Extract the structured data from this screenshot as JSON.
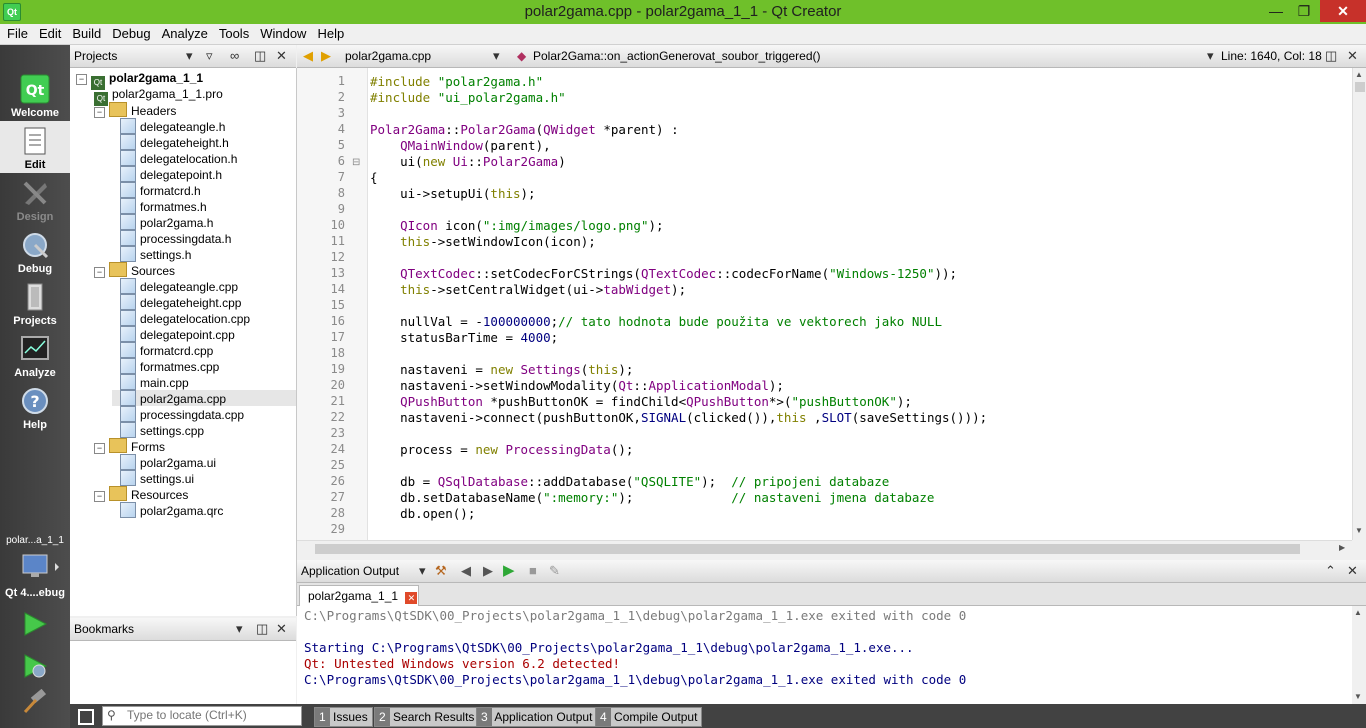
{
  "window": {
    "title": "polar2gama.cpp - polar2gama_1_1 - Qt Creator",
    "app_icon": "Qt"
  },
  "menu": [
    "File",
    "Edit",
    "Build",
    "Debug",
    "Analyze",
    "Tools",
    "Window",
    "Help"
  ],
  "modes": [
    {
      "label": "Welcome",
      "icon": "qt-logo-icon"
    },
    {
      "label": "Edit",
      "icon": "edit-document-icon"
    },
    {
      "label": "Design",
      "icon": "design-icon"
    },
    {
      "label": "Debug",
      "icon": "debug-bug-icon"
    },
    {
      "label": "Projects",
      "icon": "projects-icon"
    },
    {
      "label": "Analyze",
      "icon": "analyze-icon"
    },
    {
      "label": "Help",
      "icon": "help-icon"
    }
  ],
  "target": {
    "project": "polar...a_1_1",
    "kit": "Qt 4....ebug"
  },
  "projects_pane": {
    "title": "Projects",
    "tree": [
      {
        "label": "polar2gama_1_1",
        "level": 0,
        "kind": "project",
        "expanded": true,
        "bold": true
      },
      {
        "label": "polar2gama_1_1.pro",
        "level": 1,
        "kind": "pro"
      },
      {
        "label": "Headers",
        "level": 1,
        "kind": "folder",
        "expanded": true
      },
      {
        "label": "delegateangle.h",
        "level": 2,
        "kind": "file"
      },
      {
        "label": "delegateheight.h",
        "level": 2,
        "kind": "file"
      },
      {
        "label": "delegatelocation.h",
        "level": 2,
        "kind": "file"
      },
      {
        "label": "delegatepoint.h",
        "level": 2,
        "kind": "file"
      },
      {
        "label": "formatcrd.h",
        "level": 2,
        "kind": "file"
      },
      {
        "label": "formatmes.h",
        "level": 2,
        "kind": "file"
      },
      {
        "label": "polar2gama.h",
        "level": 2,
        "kind": "file"
      },
      {
        "label": "processingdata.h",
        "level": 2,
        "kind": "file"
      },
      {
        "label": "settings.h",
        "level": 2,
        "kind": "file"
      },
      {
        "label": "Sources",
        "level": 1,
        "kind": "folder",
        "expanded": true
      },
      {
        "label": "delegateangle.cpp",
        "level": 2,
        "kind": "file"
      },
      {
        "label": "delegateheight.cpp",
        "level": 2,
        "kind": "file"
      },
      {
        "label": "delegatelocation.cpp",
        "level": 2,
        "kind": "file"
      },
      {
        "label": "delegatepoint.cpp",
        "level": 2,
        "kind": "file"
      },
      {
        "label": "formatcrd.cpp",
        "level": 2,
        "kind": "file"
      },
      {
        "label": "formatmes.cpp",
        "level": 2,
        "kind": "file"
      },
      {
        "label": "main.cpp",
        "level": 2,
        "kind": "file"
      },
      {
        "label": "polar2gama.cpp",
        "level": 2,
        "kind": "file",
        "selected": true
      },
      {
        "label": "processingdata.cpp",
        "level": 2,
        "kind": "file"
      },
      {
        "label": "settings.cpp",
        "level": 2,
        "kind": "file"
      },
      {
        "label": "Forms",
        "level": 1,
        "kind": "folder",
        "expanded": true
      },
      {
        "label": "polar2gama.ui",
        "level": 2,
        "kind": "ui"
      },
      {
        "label": "settings.ui",
        "level": 2,
        "kind": "ui"
      },
      {
        "label": "Resources",
        "level": 1,
        "kind": "folder",
        "expanded": true
      },
      {
        "label": "polar2gama.qrc",
        "level": 2,
        "kind": "ui"
      }
    ]
  },
  "bookmarks_pane": {
    "title": "Bookmarks"
  },
  "editor": {
    "file": "polar2gama.cpp",
    "symbol": "Polar2Gama::on_actionGenerovat_soubor_triggered()",
    "position": "Line: 1640, Col: 18",
    "lines": [
      [
        [
          "kw",
          "#include "
        ],
        [
          "st",
          "\"polar2gama.h\""
        ]
      ],
      [
        [
          "kw",
          "#include "
        ],
        [
          "st",
          "\"ui_polar2gama.h\""
        ]
      ],
      [],
      [
        [
          "ty",
          "Polar2Gama"
        ],
        [
          "",
          "::"
        ],
        [
          "ty",
          "Polar2Gama"
        ],
        [
          "",
          "("
        ],
        [
          "ty",
          "QWidget"
        ],
        [
          "",
          " *parent) :"
        ]
      ],
      [
        [
          "",
          "    "
        ],
        [
          "ty",
          "QMainWindow"
        ],
        [
          "",
          "(parent),"
        ]
      ],
      [
        [
          "",
          "    ui("
        ],
        [
          "kw",
          "new"
        ],
        [
          "",
          " "
        ],
        [
          "ty",
          "Ui"
        ],
        [
          "",
          "::"
        ],
        [
          "ty",
          "Polar2Gama"
        ],
        [
          "",
          ")"
        ]
      ],
      [
        [
          "",
          "{"
        ]
      ],
      [
        [
          "",
          "    ui->setupUi("
        ],
        [
          "kw",
          "this"
        ],
        [
          "",
          ");"
        ]
      ],
      [],
      [
        [
          "",
          "    "
        ],
        [
          "ty",
          "QIcon"
        ],
        [
          "",
          " icon("
        ],
        [
          "st",
          "\":img/images/logo.png\""
        ],
        [
          "",
          ");"
        ]
      ],
      [
        [
          "",
          "    "
        ],
        [
          "kw",
          "this"
        ],
        [
          "",
          "->setWindowIcon(icon);"
        ]
      ],
      [],
      [
        [
          "",
          "    "
        ],
        [
          "ty",
          "QTextCodec"
        ],
        [
          "",
          "::setCodecForCStrings("
        ],
        [
          "ty",
          "QTextCodec"
        ],
        [
          "",
          "::codecForName("
        ],
        [
          "st",
          "\"Windows-1250\""
        ],
        [
          "",
          "));"
        ]
      ],
      [
        [
          "",
          "    "
        ],
        [
          "kw",
          "this"
        ],
        [
          "",
          "->setCentralWidget(ui->"
        ],
        [
          "ty",
          "tabWidget"
        ],
        [
          "",
          ");"
        ]
      ],
      [],
      [
        [
          "",
          "    nullVal = -"
        ],
        [
          "nm",
          "100000000"
        ],
        [
          "",
          ";"
        ],
        [
          "cm",
          "// tato hodnota bude použita ve vektorech jako NULL"
        ]
      ],
      [
        [
          "",
          "    statusBarTime = "
        ],
        [
          "nm",
          "4000"
        ],
        [
          "",
          ";"
        ]
      ],
      [],
      [
        [
          "",
          "    nastaveni = "
        ],
        [
          "kw",
          "new"
        ],
        [
          "",
          " "
        ],
        [
          "ty",
          "Settings"
        ],
        [
          "",
          "("
        ],
        [
          "kw",
          "this"
        ],
        [
          "",
          ");"
        ]
      ],
      [
        [
          "",
          "    nastaveni->setWindowModality("
        ],
        [
          "ty",
          "Qt"
        ],
        [
          "",
          "::"
        ],
        [
          "ty",
          "ApplicationModal"
        ],
        [
          "",
          ");"
        ]
      ],
      [
        [
          "",
          "    "
        ],
        [
          "ty",
          "QPushButton"
        ],
        [
          "",
          " *pushButtonOK = findChild<"
        ],
        [
          "ty",
          "QPushButton"
        ],
        [
          "",
          "*>("
        ],
        [
          "st",
          "\"pushButtonOK\""
        ],
        [
          "",
          ");"
        ]
      ],
      [
        [
          "",
          "    nastaveni->connect(pushButtonOK,"
        ],
        [
          "mac",
          "SIGNAL"
        ],
        [
          "",
          "(clicked()),"
        ],
        [
          "kw",
          "this"
        ],
        [
          "",
          " ,"
        ],
        [
          "mac",
          "SLOT"
        ],
        [
          "",
          "(saveSettings()));"
        ]
      ],
      [],
      [
        [
          "",
          "    process = "
        ],
        [
          "kw",
          "new"
        ],
        [
          "",
          " "
        ],
        [
          "ty",
          "ProcessingData"
        ],
        [
          "",
          "();"
        ]
      ],
      [],
      [
        [
          "",
          "    db = "
        ],
        [
          "ty",
          "QSqlDatabase"
        ],
        [
          "",
          "::addDatabase("
        ],
        [
          "st",
          "\"QSQLITE\""
        ],
        [
          "",
          ");  "
        ],
        [
          "cm",
          "// pripojeni databaze"
        ]
      ],
      [
        [
          "",
          "    db.setDatabaseName("
        ],
        [
          "st",
          "\":memory:\""
        ],
        [
          "",
          ");             "
        ],
        [
          "cm",
          "// nastaveni jmena databaze"
        ]
      ],
      [
        [
          "",
          "    db.open();"
        ]
      ],
      []
    ]
  },
  "output": {
    "title": "Application Output",
    "tab": "polar2gama_1_1",
    "lines": [
      {
        "text": "C:\\Programs\\QtSDK\\00_Projects\\polar2gama_1_1\\debug\\polar2gama_1_1.exe exited with code 0",
        "color": "#7a7a7a"
      },
      {
        "text": "",
        "color": "#000"
      },
      {
        "text": "Starting C:\\Programs\\QtSDK\\00_Projects\\polar2gama_1_1\\debug\\polar2gama_1_1.exe...",
        "color": "#00007f"
      },
      {
        "text": "Qt: Untested Windows version 6.2 detected!",
        "color": "#aa0000"
      },
      {
        "text": "C:\\Programs\\QtSDK\\00_Projects\\polar2gama_1_1\\debug\\polar2gama_1_1.exe exited with code 0",
        "color": "#00007f"
      }
    ]
  },
  "statusbar": {
    "locate_placeholder": "Type to locate (Ctrl+K)",
    "tabs": [
      {
        "num": "1",
        "label": "Issues"
      },
      {
        "num": "2",
        "label": "Search Results"
      },
      {
        "num": "3",
        "label": "Application Output"
      },
      {
        "num": "4",
        "label": "Compile Output"
      }
    ]
  }
}
